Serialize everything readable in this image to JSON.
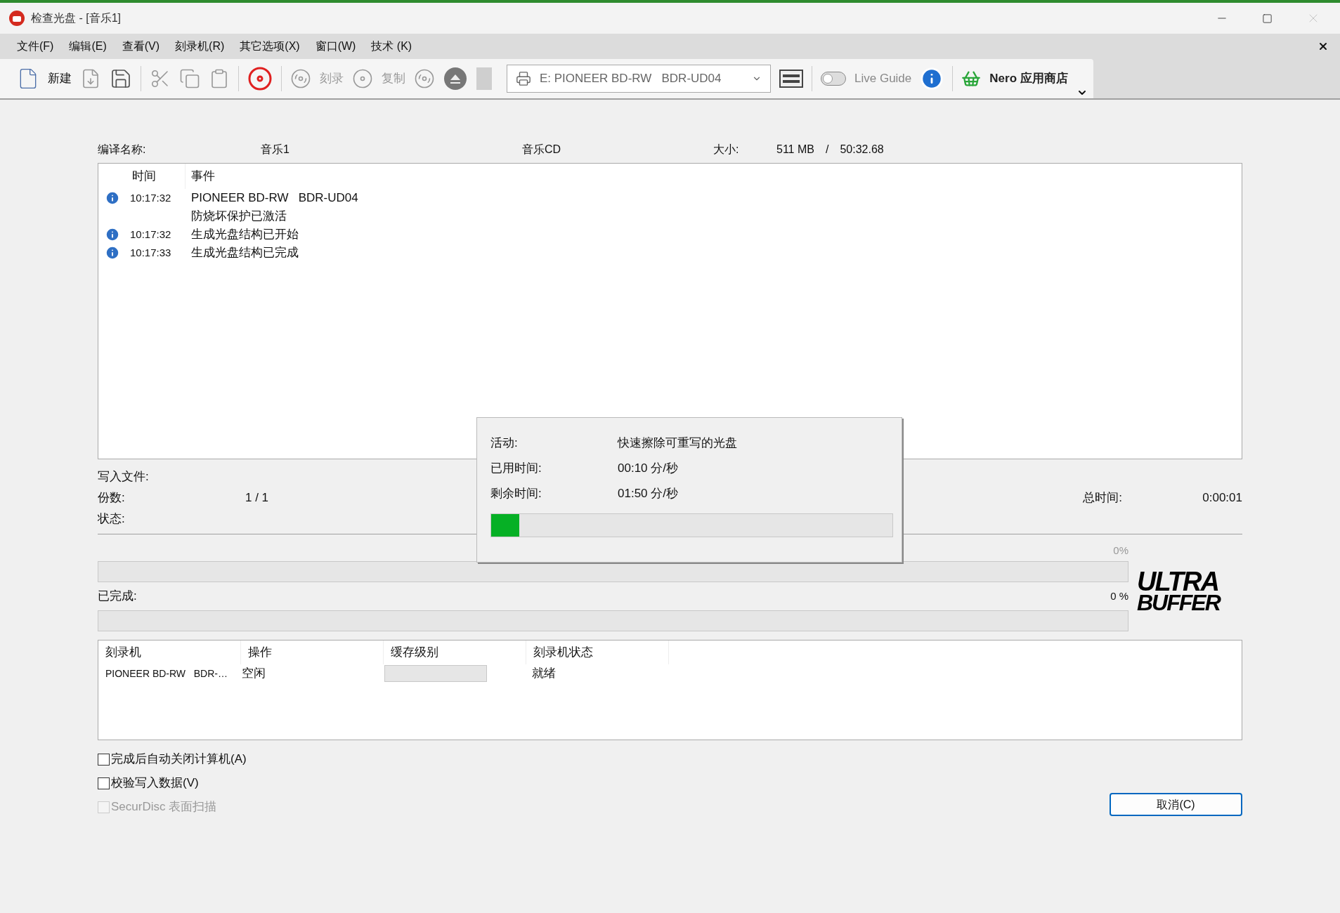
{
  "window": {
    "title": "检查光盘 - [音乐1]"
  },
  "menu": [
    "文件(F)",
    "编辑(E)",
    "查看(V)",
    "刻录机(R)",
    "其它选项(X)",
    "窗口(W)",
    "技术 (K)"
  ],
  "toolbar": {
    "new_label": "新建",
    "burn": {
      "label": "刻录",
      "disabled": true
    },
    "copy": {
      "label": "复制",
      "disabled": true
    },
    "drive": "E: PIONEER BD-RW   BDR-UD04",
    "live_guide": {
      "label": "Live Guide",
      "on": false
    },
    "store": "Nero 应用商店"
  },
  "compilation": {
    "name_label": "编译名称:",
    "name": "音乐1",
    "type": "音乐CD",
    "size_label": "大小:",
    "size": "511 MB",
    "separator": "/",
    "duration": "50:32.68"
  },
  "log": {
    "columns": [
      "时间",
      "事件"
    ],
    "entries": [
      {
        "time": "10:17:32",
        "lines": [
          "PIONEER BD-RW   BDR-UD04",
          "防烧坏保护已激活"
        ]
      },
      {
        "time": "10:17:32",
        "lines": [
          "生成光盘结构已开始"
        ]
      },
      {
        "time": "10:17:33",
        "lines": [
          "生成光盘结构已完成"
        ]
      }
    ]
  },
  "status": {
    "rows": [
      {
        "label": "写入文件:"
      },
      {
        "label": "份数:",
        "value": "1 / 1"
      },
      {
        "label": "状态:"
      }
    ],
    "total_label": "总时间:",
    "total": "0:00:01"
  },
  "progress": {
    "percent": "0%",
    "level": 0
  },
  "completed": {
    "label": "已完成:",
    "percent": "0 %",
    "level": 0
  },
  "logo": [
    "ULTRA",
    "BUFFER"
  ],
  "burners": {
    "columns": [
      "刻录机",
      "操作",
      "缓存级别",
      "刻录机状态"
    ],
    "rows": [
      {
        "burner": "PIONEER BD-RW   BDR-…",
        "operation": "空闲",
        "level": 0,
        "state": "就绪"
      }
    ]
  },
  "options": [
    {
      "label": "完成后自动关闭计算机(A)",
      "checked": false,
      "disabled": false
    },
    {
      "label": "校验写入数据(V)",
      "checked": false,
      "disabled": false
    },
    {
      "label": "SecurDisc 表面扫描",
      "checked": false,
      "disabled": true
    }
  ],
  "cancel": "取消(C)",
  "popup": {
    "rows": [
      {
        "label": "活动:",
        "value": "快速擦除可重写的光盘"
      },
      {
        "label": "已用时间:",
        "value": "00:10 分/秒"
      },
      {
        "label": "剩余时间:",
        "value": "01:50 分/秒"
      }
    ],
    "level": 0.07
  }
}
